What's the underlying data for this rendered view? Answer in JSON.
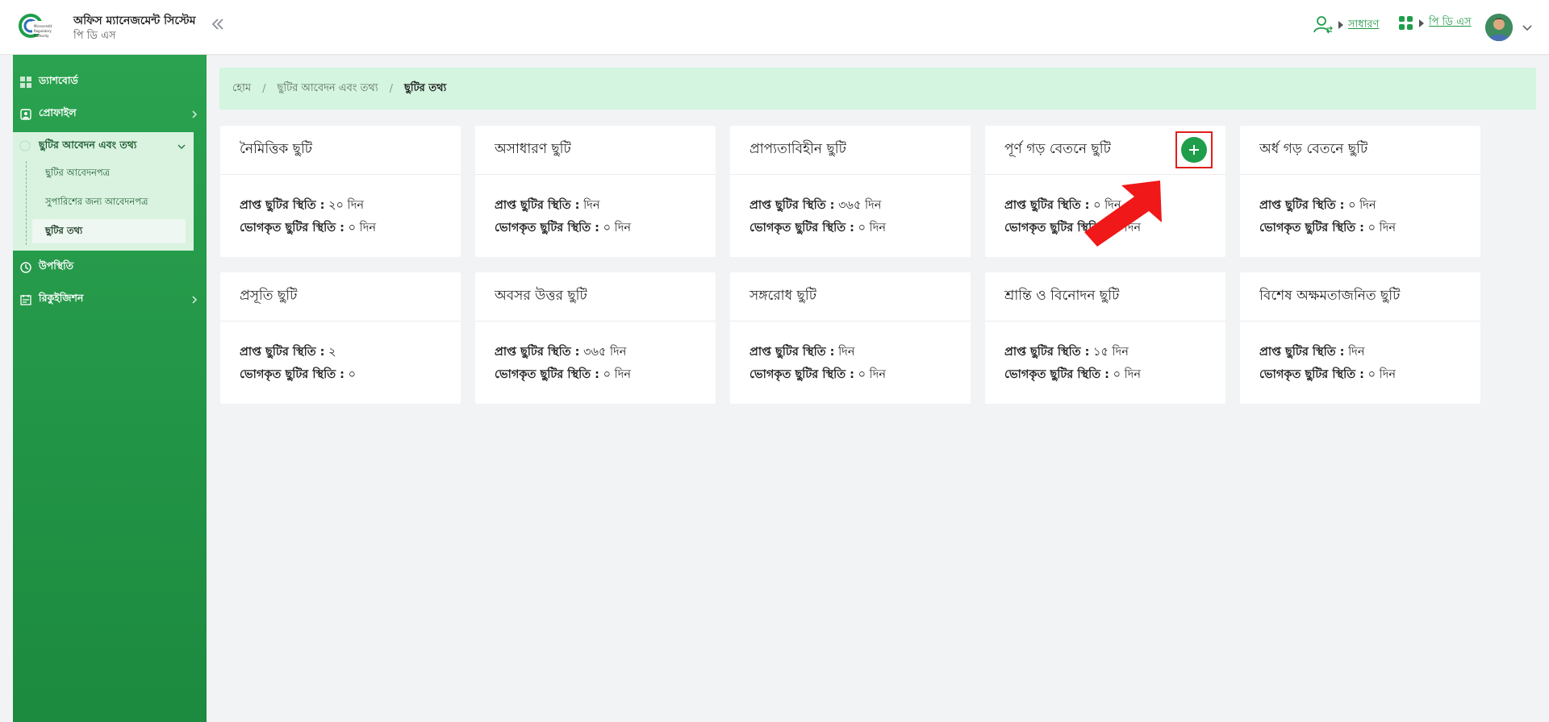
{
  "header": {
    "app_title": "অফিস ম্যানেজমেন্ট সিস্টেম",
    "app_subtitle": "পি ডি এস",
    "role_label": "সাধারণ",
    "module_label": "পি ডি এস"
  },
  "sidebar": {
    "items": [
      {
        "label": "ড্যাশবোর্ড"
      },
      {
        "label": "প্রোফাইল"
      },
      {
        "label": "ছুটির আবেদন এবং তথ্য"
      },
      {
        "label": "উপস্থিতি"
      },
      {
        "label": "রিকুইজিশন"
      }
    ],
    "sub_items": [
      {
        "label": "ছুটির আবেদনপত্র"
      },
      {
        "label": "সুপারিশের জন্য আবেদনপত্র"
      },
      {
        "label": "ছুটির তথ্য"
      }
    ]
  },
  "breadcrumb": {
    "home": "হোম",
    "parent": "ছুটির আবেদন এবং তথ্য",
    "current": "ছুটির তথ্য",
    "sep": "/"
  },
  "labels": {
    "received": "প্রাপ্ত ছুটির স্থিতি :",
    "used": "ভোগকৃত ছুটির স্থিতি :"
  },
  "cards": [
    {
      "title": "নৈমিত্তিক ছুটি",
      "received": "২০ দিন",
      "used": "০ দিন"
    },
    {
      "title": "অসাধারণ ছুটি",
      "received": "দিন",
      "used": "০ দিন"
    },
    {
      "title": "প্রাপ্যতাবিহীন ছুটি",
      "received": "৩৬৫ দিন",
      "used": "০ দিন"
    },
    {
      "title": "পূর্ণ গড় বেতনে ছুটি",
      "received": "০ দিন",
      "used": "০ দিন"
    },
    {
      "title": "অর্ধ গড় বেতনে ছুটি",
      "received": "০ দিন",
      "used": "০ দিন"
    },
    {
      "title": "প্রসূতি ছুটি",
      "received": "২",
      "used": "০"
    },
    {
      "title": "অবসর উত্তর ছুটি",
      "received": "৩৬৫ দিন",
      "used": "০ দিন"
    },
    {
      "title": "সঙ্গরোধ ছুটি",
      "received": "দিন",
      "used": "০ দিন"
    },
    {
      "title": "শ্রান্তি ও বিনোদন ছুটি",
      "received": "১৫ দিন",
      "used": "০ দিন"
    },
    {
      "title": "বিশেষ অক্ষমতাজনিত ছুটি",
      "received": "দিন",
      "used": "০ দিন"
    }
  ],
  "colors": {
    "brand_green": "#1e9e4a",
    "highlight_red": "#e0201b",
    "breadcrumb_bg": "#d4f5df"
  }
}
